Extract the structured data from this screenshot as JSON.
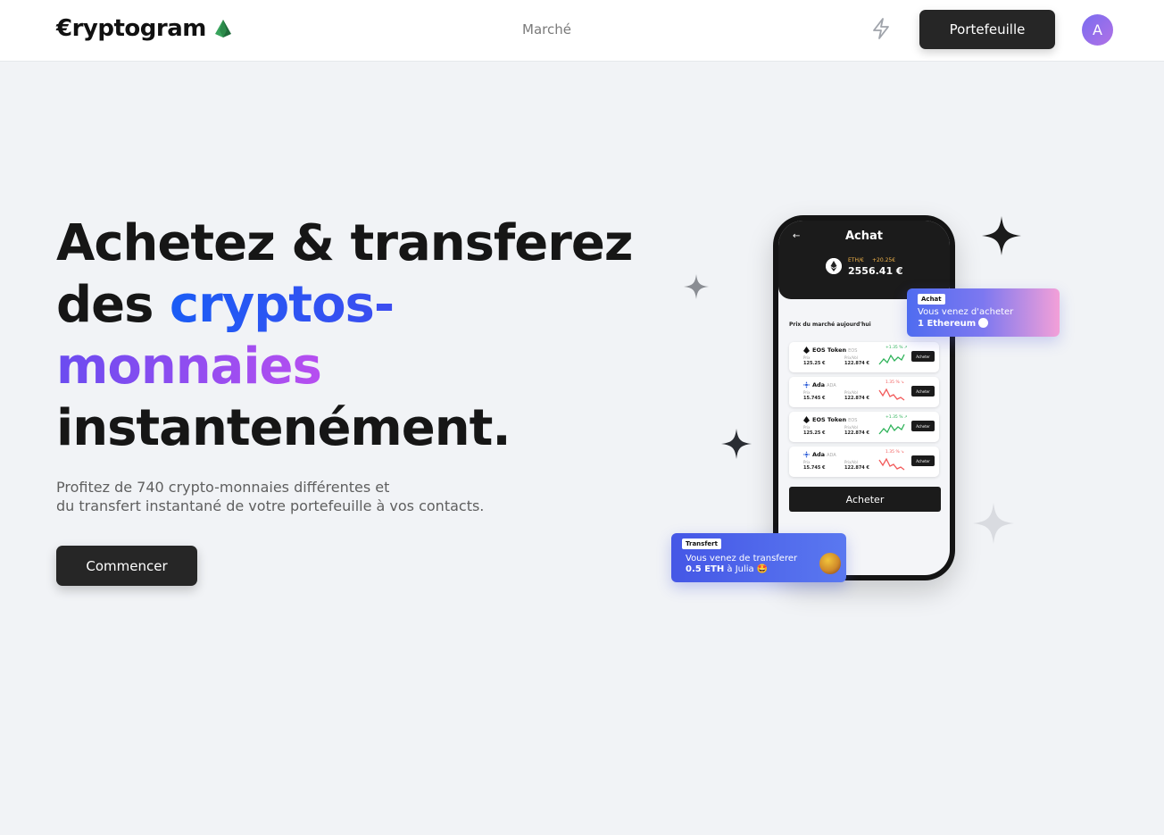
{
  "nav": {
    "brand": "€ryptogram",
    "market_link": "Marché",
    "wallet_button": "Portefeuille",
    "avatar_initial": "A"
  },
  "hero": {
    "title_line1": "Achetez & transferez",
    "title_line2_prefix": "des ",
    "title_line2_gradient": "cryptos-",
    "title_line3_gradient": "monnaies",
    "title_line4": "instantenément.",
    "subtitle_line1": "Profitez de 740 crypto-monnaies différentes et",
    "subtitle_line2": "du transfert instantané de votre portefeuille à vos contacts.",
    "cta": "Commencer"
  },
  "phone": {
    "back": "←",
    "title": "Achat",
    "pair": "ETH/€",
    "change": "+20.25€",
    "price": "2556.41 €",
    "section": "Prix du marché aujourd'hui",
    "rows": [
      {
        "name": "EOS Token",
        "ticker": "EOS",
        "prix_label": "Prix",
        "prix": "125.25 €",
        "vol_label": "Prix/Vol",
        "vol": "122.874 €",
        "pct": "+1.35 % ↗",
        "trend": "up",
        "button": "Acheter"
      },
      {
        "name": "Ada",
        "ticker": "ADA",
        "prix_label": "Prix",
        "prix": "15.745 €",
        "vol_label": "Prix/Vol",
        "vol": "122.874 €",
        "pct": "1.35 % ↘",
        "trend": "down",
        "button": "Acheter"
      },
      {
        "name": "EOS Token",
        "ticker": "EOS",
        "prix_label": "Prix",
        "prix": "125.25 €",
        "vol_label": "Prix/Vol",
        "vol": "122.874 €",
        "pct": "+1.35 % ↗",
        "trend": "up",
        "button": "Acheter"
      },
      {
        "name": "Ada",
        "ticker": "ADA",
        "prix_label": "Prix",
        "prix": "15.745 €",
        "vol_label": "Prix/Vol",
        "vol": "122.874 €",
        "pct": "1.35 % ↘",
        "trend": "down",
        "button": "Acheter"
      }
    ],
    "buy_button": "Acheter"
  },
  "toasts": {
    "buy_tag": "Achat",
    "buy_line1": "Vous venez d'acheter",
    "buy_line2": "1 Ethereum",
    "transfer_tag": "Transfert",
    "transfer_line1": "Vous venez de transferer",
    "transfer_amount": "0.5 ETH",
    "transfer_to": " à Julia 🤩"
  },
  "colors": {
    "accent_blue": "#1b5cf5",
    "accent_purple": "#b74ef0",
    "dark_button": "#262626",
    "up_green": "#2fb35a",
    "down_red": "#f25a5a"
  },
  "icons": [
    "gem-icon",
    "bolt-icon",
    "sparkle-icon",
    "ethereum-icon",
    "eos-icon",
    "ada-icon"
  ]
}
